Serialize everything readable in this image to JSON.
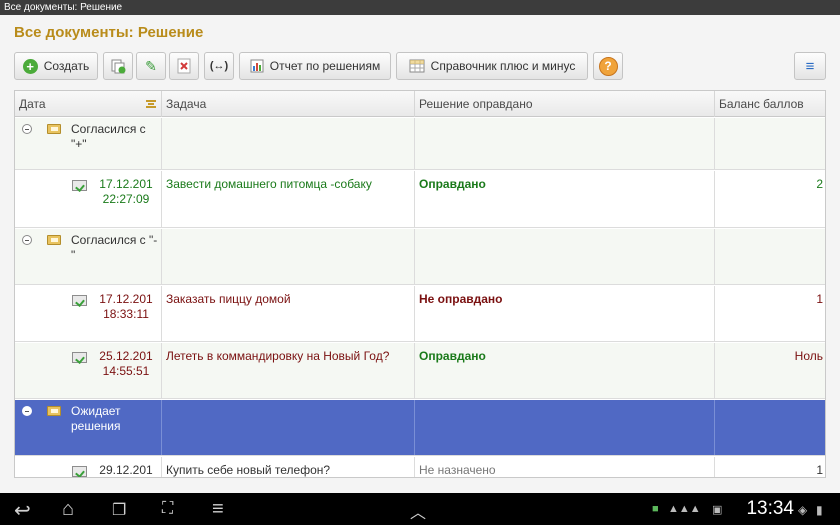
{
  "window": {
    "title": "Все документы: Решение"
  },
  "page": {
    "title": "Все документы: Решение"
  },
  "toolbar": {
    "create_label": "Создать",
    "report_label": "Отчет по решениям",
    "directory_label": "Справочник плюс и минус",
    "help_label": "?"
  },
  "grid": {
    "columns": {
      "date": "Дата",
      "task": "Задача",
      "decision": "Решение оправдано",
      "balance": "Баланс баллов"
    },
    "rows": [
      {
        "kind": "group",
        "label": "Согласился с \"+\""
      },
      {
        "kind": "item",
        "date": "17.12.201",
        "time": "22:27:09",
        "task": "Завести домашнего питомца -собаку",
        "decision": "Оправдано",
        "balance": "2"
      },
      {
        "kind": "group",
        "label": "Согласился с \"-\""
      },
      {
        "kind": "item",
        "date": "17.12.201",
        "time": "18:33:11",
        "task": "Заказать пиццу домой",
        "decision": "Не оправдано",
        "balance": "1"
      },
      {
        "kind": "item",
        "date": "25.12.201",
        "time": "14:55:51",
        "task": "Лететь в коммандировку на Новый Год?",
        "decision": "Оправдано",
        "balance": "Ноль"
      },
      {
        "kind": "group",
        "label": "Ожидает решения",
        "selected": true
      },
      {
        "kind": "item",
        "date": "29.12.201",
        "time": "",
        "task": "Купить себе  новый телефон?",
        "decision": "Не назначено",
        "balance": "1"
      }
    ]
  },
  "statusbar": {
    "clock": "13:34"
  },
  "icons": [
    "add-icon",
    "copy-icon",
    "edit-icon",
    "delete-icon",
    "swap-icon",
    "report-icon",
    "table-icon",
    "help-icon",
    "menu-icon",
    "sort-icon",
    "collapse-icon",
    "folder-icon",
    "document-posted-icon",
    "back-icon",
    "home-icon",
    "recent-apps-icon",
    "screenshot-icon",
    "menu-nav-icon",
    "up-arrow-icon"
  ]
}
